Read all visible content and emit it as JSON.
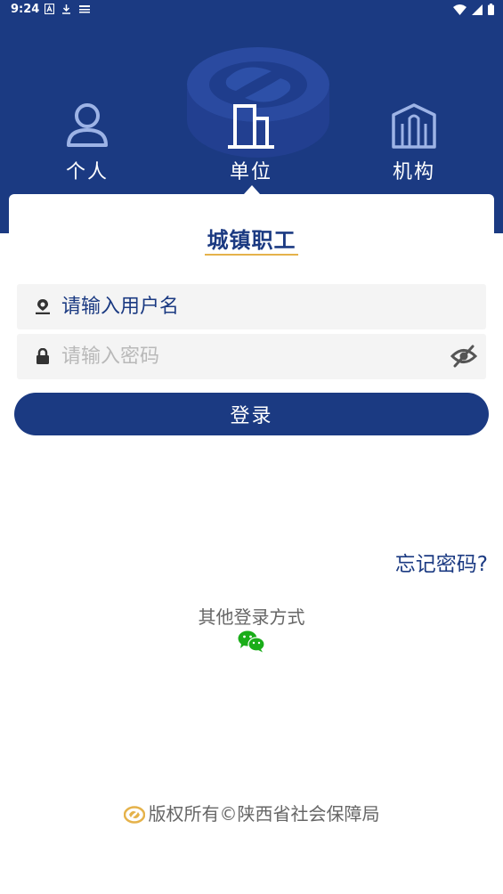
{
  "status_bar": {
    "time": "9:24",
    "icons": [
      "a-icon",
      "download-icon",
      "notification-icon",
      "wifi-icon",
      "signal-icon",
      "battery-icon"
    ]
  },
  "tabs": [
    {
      "label": "个人",
      "icon": "person-icon"
    },
    {
      "label": "单位",
      "icon": "building-icon",
      "active": true
    },
    {
      "label": "机构",
      "icon": "institution-icon"
    }
  ],
  "card": {
    "title": "城镇职工"
  },
  "form": {
    "username_placeholder": "请输入用户名",
    "password_placeholder": "请输入密码",
    "login_label": "登录",
    "forgot_label": "忘记密码?"
  },
  "other_login": {
    "label": "其他登录方式",
    "icon": "wechat-icon"
  },
  "footer": {
    "copyright": "版权所有©陕西省社会保障局"
  },
  "colors": {
    "primary": "#1b3a82",
    "accent": "#e5b24a",
    "wechat": "#1aad19"
  }
}
